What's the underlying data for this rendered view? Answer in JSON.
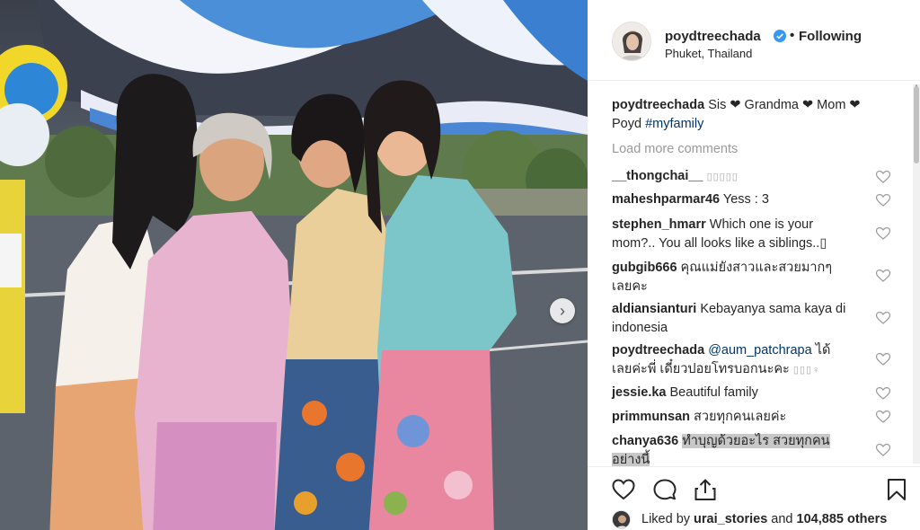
{
  "post": {
    "username": "poydtreechada",
    "follow_status": "Following",
    "separator": "•",
    "location": "Phuket, Thailand",
    "verified": true
  },
  "caption": {
    "username": "poydtreechada",
    "text": "Sis ❤ Grandma ❤ Mom ❤",
    "text2": "Poyd",
    "hashtag": "#myfamily"
  },
  "load_more_label": "Load more comments",
  "comments": [
    {
      "username": "__thongchai__",
      "text": "▯▯▯▯▯"
    },
    {
      "username": "maheshparmar46",
      "text": "Yess : 3"
    },
    {
      "username": "stephen_hmarr",
      "text": "Which one is your",
      "text2": "mom?.. You all looks like a siblings..▯"
    },
    {
      "username": "gubgib666",
      "text": "คุณแม่ยังสาวและสวยมากๆ",
      "text2": "เลยคะ"
    },
    {
      "username": "aldiansianturi",
      "text": "Kebayanya sama kaya di",
      "text2": "indonesia"
    },
    {
      "username": "poydtreechada",
      "mention": "@aum_patchrapa",
      "text": "ได้",
      "text2": "เลยค่ะพี่ เดี๋ยวปอยโทรบอกนะคะ",
      "glyphs": "▯▯▯♀"
    },
    {
      "username": "jessie.ka",
      "text": "Beautiful family"
    },
    {
      "username": "primmunsan",
      "text": "สวยทุกคนเลยค่ะ"
    },
    {
      "username": "chanya636",
      "text": "ทำบุญด้วยอะไร สวยทุกคน",
      "text2": "อย่างนี้"
    }
  ],
  "likes": {
    "prefix": "Liked by",
    "user": "urai_stories",
    "middle": "and",
    "count": "104,885 others"
  },
  "icons": {
    "like": "heart-icon",
    "comment": "comment-icon",
    "share": "share-icon",
    "save": "bookmark-icon",
    "next": "chevron-right-icon",
    "verified": "verified-badge-icon"
  },
  "colors": {
    "verified": "#3897f0",
    "mention": "#003569",
    "muted": "#999999",
    "text": "#262626"
  }
}
